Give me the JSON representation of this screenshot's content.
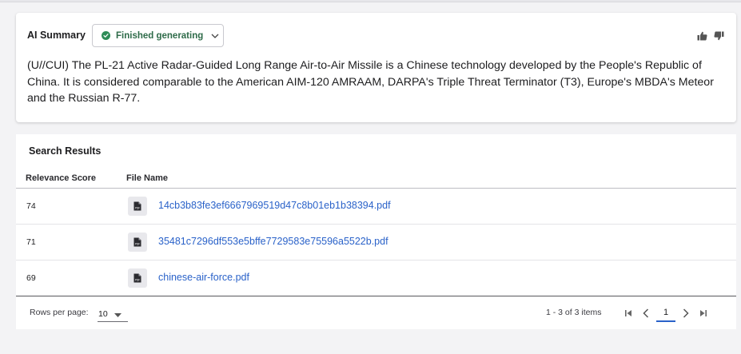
{
  "summary": {
    "title": "AI Summary",
    "status": "Finished generating",
    "text": "(U//CUI) The PL-21 Active Radar-Guided Long Range Air-to-Air Missile is a Chinese technology developed by the People's Republic of China. It is considered comparable to the American AIM-120 AMRAAM, DARPA's Triple Threat Terminator (T3), Europe's MBDA's Meteor and the Russian R-77."
  },
  "results": {
    "title": "Search Results",
    "columns": [
      "Relevance Score",
      "File Name"
    ],
    "rows": [
      {
        "score": "74",
        "file": "14cb3b83fe3ef6667969519d47c8b01eb1b38394.pdf"
      },
      {
        "score": "71",
        "file": "35481c7296df553e5bffe7729583e75596a5522b.pdf"
      },
      {
        "score": "69",
        "file": "chinese-air-force.pdf"
      }
    ],
    "file_icon_text": "PDF"
  },
  "pagination": {
    "rows_per_page_label": "Rows per page:",
    "rows_per_page_value": "10",
    "range_label": "1 - 3 of 3 items",
    "current_page": "1"
  },
  "colors": {
    "status_green": "#2e8b57",
    "link_blue": "#2a62c9"
  },
  "icons": [
    "check-circle-icon",
    "chevron-down-icon",
    "thumbs-up-icon",
    "thumbs-down-icon",
    "pdf-file-icon",
    "first-page-icon",
    "prev-page-icon",
    "next-page-icon",
    "last-page-icon",
    "caret-down-icon"
  ]
}
